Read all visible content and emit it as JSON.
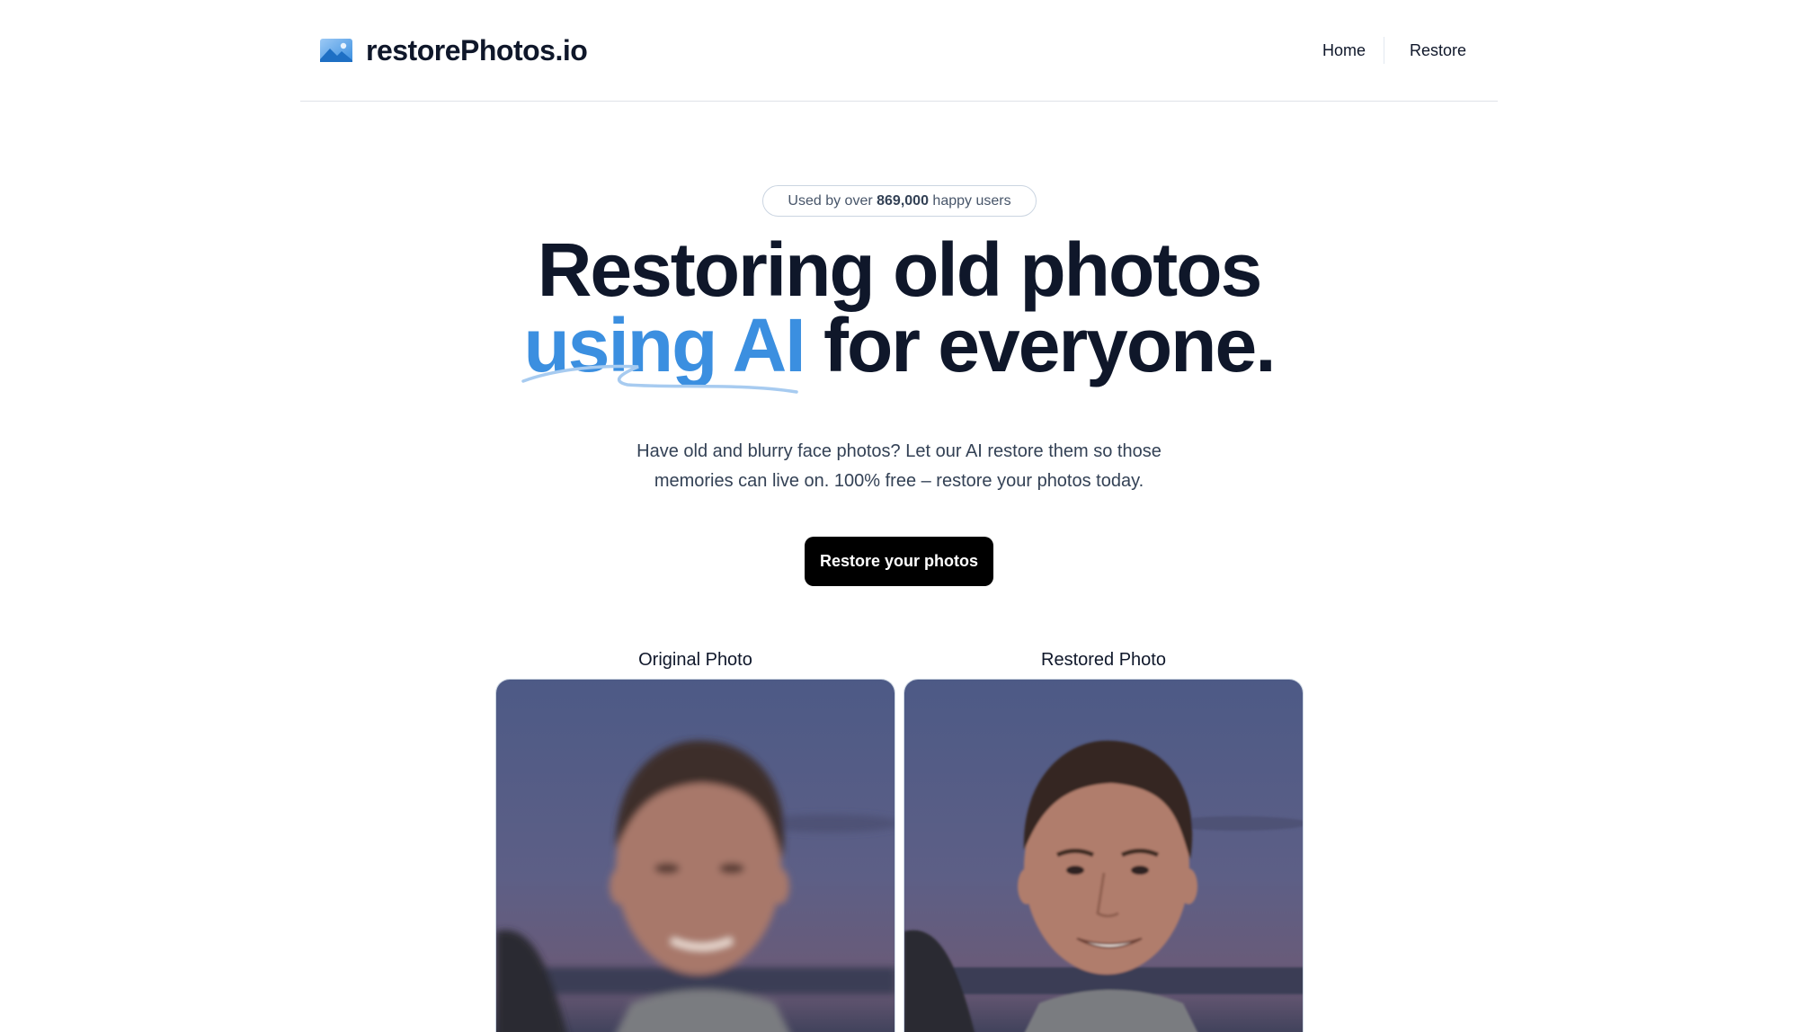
{
  "header": {
    "brand": "restorePhotos.io",
    "nav": [
      {
        "label": "Home"
      },
      {
        "label": "Restore"
      }
    ]
  },
  "hero": {
    "badge_prefix": "Used by over",
    "badge_count": "869,000",
    "badge_suffix": "happy users",
    "title_line1": "Restoring old photos",
    "title_accent": "using AI",
    "title_line2_rest": "for everyone.",
    "subtitle": "Have old and blurry face photos? Let our AI restore them so those memories can live on. 100% free – restore your photos today.",
    "cta_label": "Restore your photos"
  },
  "comparison": {
    "original_label": "Original Photo",
    "restored_label": "Restored Photo"
  },
  "colors": {
    "accent": "#3b8fe0",
    "text": "#0f172a",
    "cta_bg": "#000000"
  }
}
